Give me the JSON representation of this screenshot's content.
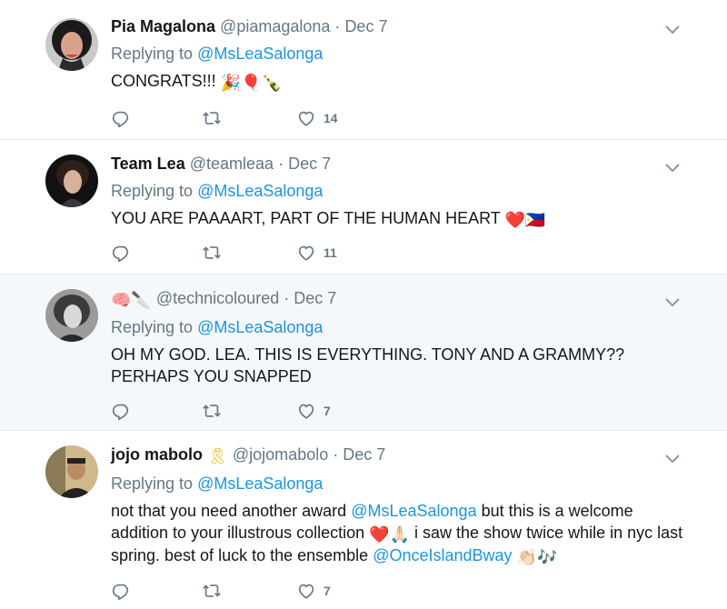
{
  "replying_label": "Replying to",
  "replying_to": "@MsLeaSalonga",
  "tweets": [
    {
      "name": "Pia Magalona",
      "handle": "@piamagalona",
      "separator": "·",
      "date": "Dec 7",
      "text": "CONGRATS!!!",
      "emojis": [
        "🎉",
        "🎈",
        "🍾"
      ],
      "likes": "14"
    },
    {
      "name": "Team Lea",
      "handle": "@teamleaa",
      "separator": "·",
      "date": "Dec 7",
      "text": "YOU ARE PAAAART, PART OF THE HUMAN HEART",
      "emojis": [
        "❤️",
        "🇵🇭"
      ],
      "likes": "11"
    },
    {
      "name_emojis": [
        "🧠",
        "🔪"
      ],
      "handle": "@technicoloured",
      "separator": "·",
      "date": "Dec 7",
      "text": "OH MY GOD. LEA. THIS IS EVERYTHING. TONY AND A GRAMMY?? PERHAPS YOU SNAPPED",
      "likes": "7"
    },
    {
      "name": "jojo mabolo",
      "name_emoji": "🎗",
      "handle": "@jojomabolo",
      "separator": "·",
      "date": "Dec 7",
      "text_part1": "not that you need another award",
      "mention1": "@MsLeaSalonga",
      "text_part2": "but this is a welcome addition to your illustrous collection",
      "emojis_mid": [
        "❤️",
        "🙏🏻"
      ],
      "text_part3": "i saw the show twice while in nyc last spring. best of luck to the ensemble",
      "mention2": "@OnceIslandBway",
      "emojis_end": [
        "👏🏻",
        "🎶"
      ],
      "likes": "7"
    }
  ],
  "colors": {
    "link": "#1b95e0",
    "muted": "#657786",
    "highlight_bg": "#f5f8fa",
    "border": "#e6ecf0"
  },
  "icons": [
    "reply-icon",
    "retweet-icon",
    "like-icon",
    "chevron-down-icon"
  ]
}
